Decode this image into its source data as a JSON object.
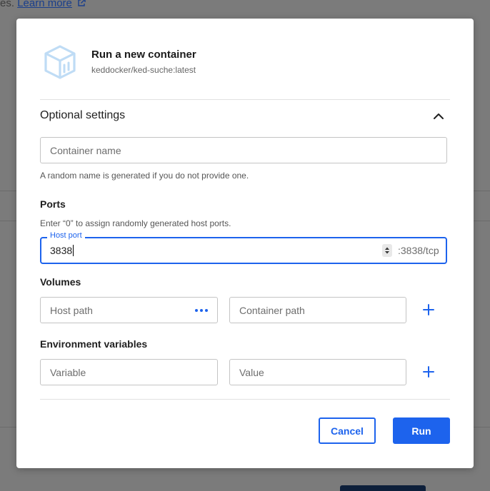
{
  "background": {
    "top_text": "es.",
    "learn_more": "Learn more"
  },
  "dialog": {
    "title": "Run a new container",
    "image_name": "keddocker/ked-suche:latest",
    "optional_settings": "Optional settings",
    "container_name": {
      "placeholder": "Container name",
      "hint": "A random name is generated if you do not provide one."
    },
    "ports": {
      "label": "Ports",
      "hint": "Enter “0” to assign randomly generated host ports.",
      "host_port_label": "Host port",
      "host_port_value": "3838",
      "container_port": ":3838/tcp"
    },
    "volumes": {
      "label": "Volumes",
      "host_path_placeholder": "Host path",
      "container_path_placeholder": "Container path"
    },
    "env": {
      "label": "Environment variables",
      "variable_placeholder": "Variable",
      "value_placeholder": "Value"
    },
    "buttons": {
      "cancel": "Cancel",
      "run": "Run"
    }
  },
  "colors": {
    "accent": "#1d63ed",
    "overlay": "#7b7b7b"
  },
  "icons": [
    "container-logo-icon",
    "external-link-icon",
    "chevron-up-icon",
    "more-dots-icon",
    "plus-icon",
    "spinner-arrows-icon"
  ]
}
